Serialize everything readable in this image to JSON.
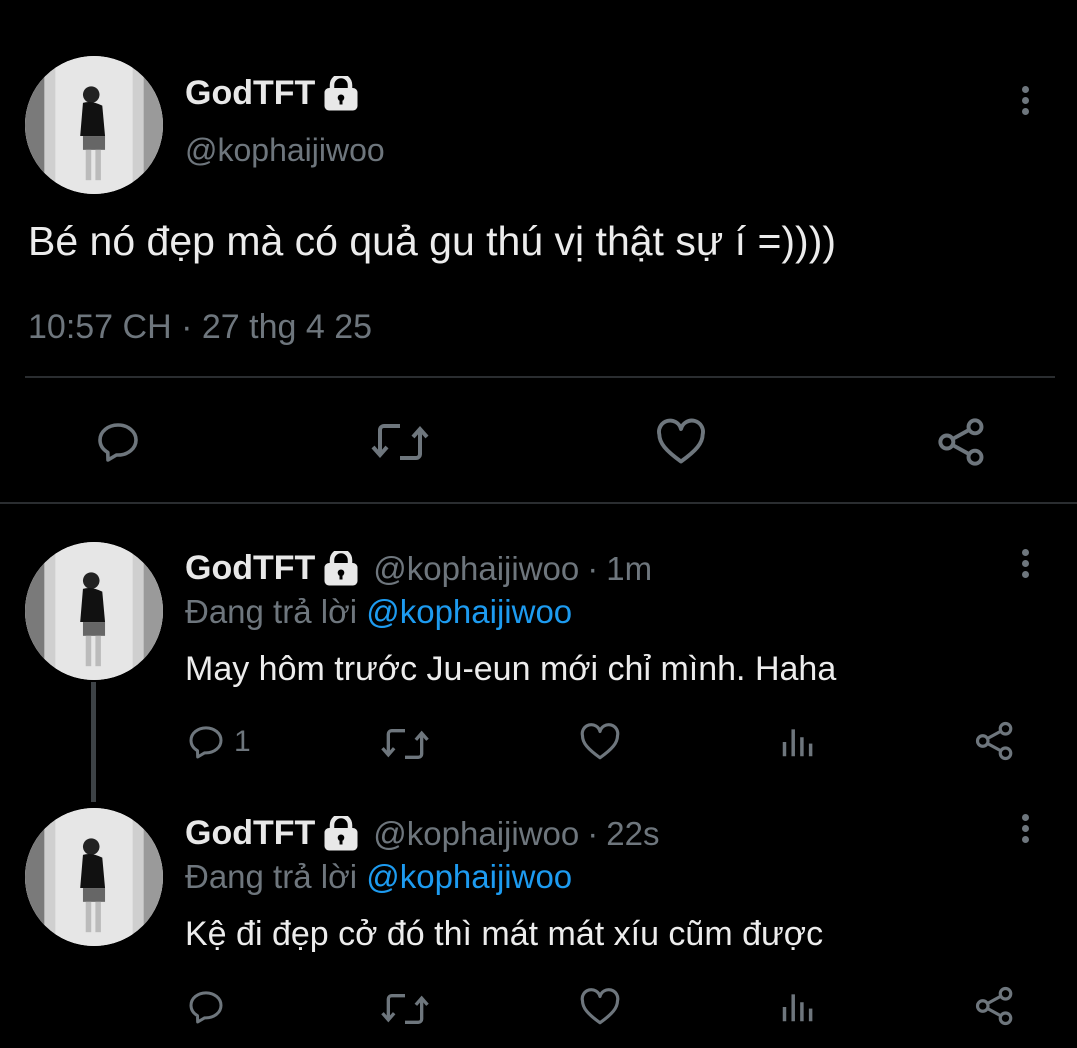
{
  "main_tweet": {
    "display_name": "GodTFT",
    "handle": "@kophaijiwoo",
    "text": "Bé nó đẹp mà có quả gu thú vị thật sự í =))))",
    "time": "10:57 CH",
    "separator": "·",
    "date": "27 thg 4 25"
  },
  "replies": [
    {
      "display_name": "GodTFT",
      "handle": "@kophaijiwoo",
      "age": "1m",
      "replying_prefix": "Đang trả lời",
      "replying_to": "@kophaijiwoo",
      "text": "May hôm trước Ju-eun mới chỉ mình. Haha",
      "reply_count": "1"
    },
    {
      "display_name": "GodTFT",
      "handle": "@kophaijiwoo",
      "age": "22s",
      "replying_prefix": "Đang trả lời",
      "replying_to": "@kophaijiwoo",
      "text": "Kệ đi đẹp cở đó thì mát mát xíu cũm được",
      "reply_count": ""
    }
  ],
  "icons": {
    "reply": "reply-icon",
    "retweet": "retweet-icon",
    "like": "heart-icon",
    "share": "share-icon",
    "analytics": "analytics-icon",
    "more": "more-icon",
    "lock": "lock-icon"
  },
  "colors": {
    "background": "#000000",
    "text": "#ececec",
    "muted": "#6e767d",
    "mention": "#1d9bf0",
    "divider": "#2a2d30"
  }
}
